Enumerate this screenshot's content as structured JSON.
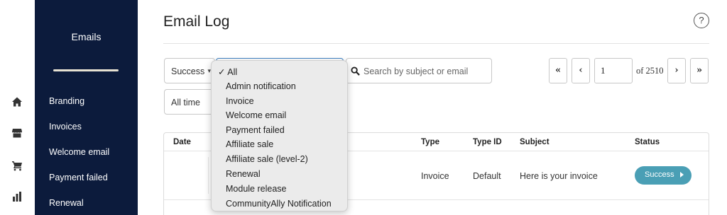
{
  "rail": {
    "icons": [
      "home-icon",
      "store-icon",
      "cart-icon",
      "bar-chart-icon"
    ]
  },
  "sidebar": {
    "title": "Emails",
    "items": [
      {
        "label": "Branding"
      },
      {
        "label": "Invoices"
      },
      {
        "label": "Welcome email"
      },
      {
        "label": "Payment failed"
      },
      {
        "label": "Renewal"
      }
    ]
  },
  "header": {
    "title": "Email Log",
    "help_icon": "?"
  },
  "filters": {
    "status_value": "Success",
    "time_value": "All time",
    "search_placeholder": "Search by subject or email"
  },
  "type_dropdown": {
    "check": "✓",
    "selected": "All",
    "options": [
      "All",
      "Admin notification",
      "Invoice",
      "Welcome email",
      "Payment failed",
      "Affiliate sale",
      "Affiliate sale (level-2)",
      "Renewal",
      "Module release",
      "CommunityAlly Notification"
    ]
  },
  "pagination": {
    "first": "«",
    "prev": "‹",
    "page": "1",
    "of_text": "of 2510",
    "next": "›",
    "last": "»"
  },
  "table": {
    "columns": [
      "Date",
      "Type",
      "Type ID",
      "Subject",
      "Status"
    ],
    "rows": [
      {
        "date": "",
        "type": "Invoice",
        "type_id": "Default",
        "subject": "Here is your invoice",
        "status": "Success"
      }
    ]
  },
  "colors": {
    "sidebar_bg": "#0c1b3c",
    "status_badge": "#4a9fb5",
    "focus_border": "#3d7fc1"
  }
}
